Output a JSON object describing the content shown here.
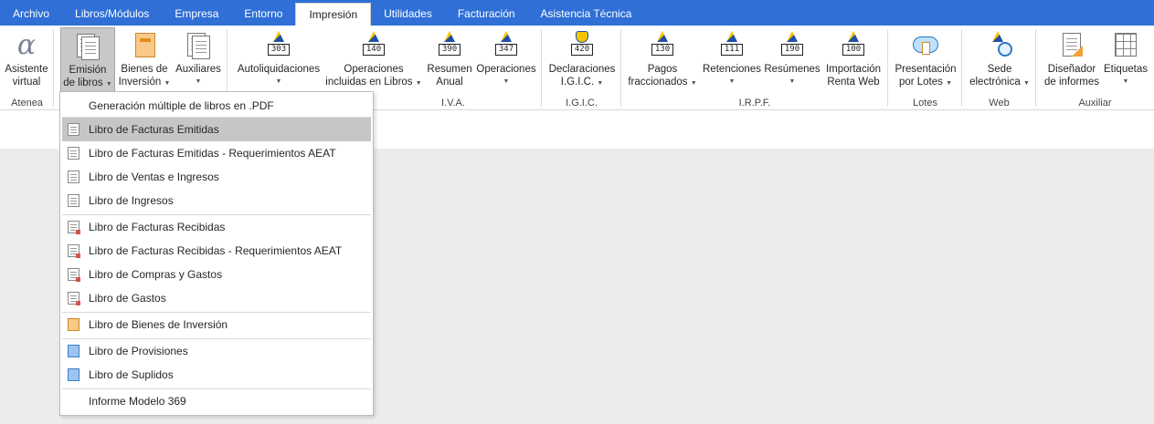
{
  "menu": {
    "tabs": [
      "Archivo",
      "Libros/Módulos",
      "Empresa",
      "Entorno",
      "Impresión",
      "Utilidades",
      "Facturación",
      "Asistencia Técnica"
    ],
    "active_tab": "Impresión"
  },
  "ribbon": {
    "groups": {
      "atenea": "Atenea",
      "iva": "I.V.A.",
      "igic": "I.G.I.C.",
      "irpf": "I.R.P.F.",
      "lotes": "Lotes",
      "web": "Web",
      "auxiliar": "Auxiliar"
    },
    "buttons": {
      "asistente": [
        "Asistente",
        "virtual"
      ],
      "emision": [
        "Emisión",
        "de libros"
      ],
      "bienes": [
        "Bienes de",
        "Inversión"
      ],
      "auxiliares": [
        "Auxiliares",
        ""
      ],
      "autoliquidaciones": [
        "Autoliquidaciones",
        ""
      ],
      "operaciones_libros": [
        "Operaciones",
        "incluidas en Libros"
      ],
      "resumen_anual": [
        "Resumen",
        "Anual"
      ],
      "operaciones": [
        "Operaciones",
        ""
      ],
      "declaraciones": [
        "Declaraciones",
        "I.G.I.C."
      ],
      "pagos": [
        "Pagos",
        "fraccionados"
      ],
      "retenciones": [
        "Retenciones",
        ""
      ],
      "resumenes": [
        "Resúmenes",
        ""
      ],
      "importacion": [
        "Importación",
        "Renta Web"
      ],
      "presentacion": [
        "Presentación",
        "por Lotes"
      ],
      "sede": [
        "Sede",
        "electrónica"
      ],
      "disenador": [
        "Diseñador",
        "de informes"
      ],
      "etiquetas": [
        "Etiquetas",
        ""
      ]
    },
    "model_numbers": {
      "autoliquidaciones": "303",
      "operaciones_libros": "140",
      "resumen_anual": "390",
      "operaciones": "347",
      "declaraciones": "420",
      "pagos": "130",
      "retenciones": "111",
      "resumenes": "190",
      "importacion": "100"
    }
  },
  "dropdown": {
    "items": [
      "Generación múltiple de libros en .PDF",
      "Libro de Facturas Emitidas",
      "Libro de Facturas Emitidas - Requerimientos AEAT",
      "Libro de Ventas e Ingresos",
      "Libro de Ingresos",
      "Libro de Facturas Recibidas",
      "Libro de Facturas Recibidas - Requerimientos AEAT",
      "Libro de Compras y Gastos",
      "Libro de Gastos",
      "Libro de Bienes de Inversión",
      "Libro de Provisiones",
      "Libro de Suplidos",
      "Informe Modelo 369"
    ],
    "highlighted": "Libro de Facturas Emitidas"
  },
  "colors": {
    "menubar": "#2f6fd6",
    "highlight": "#c6c6c6",
    "background": "#ececec"
  }
}
